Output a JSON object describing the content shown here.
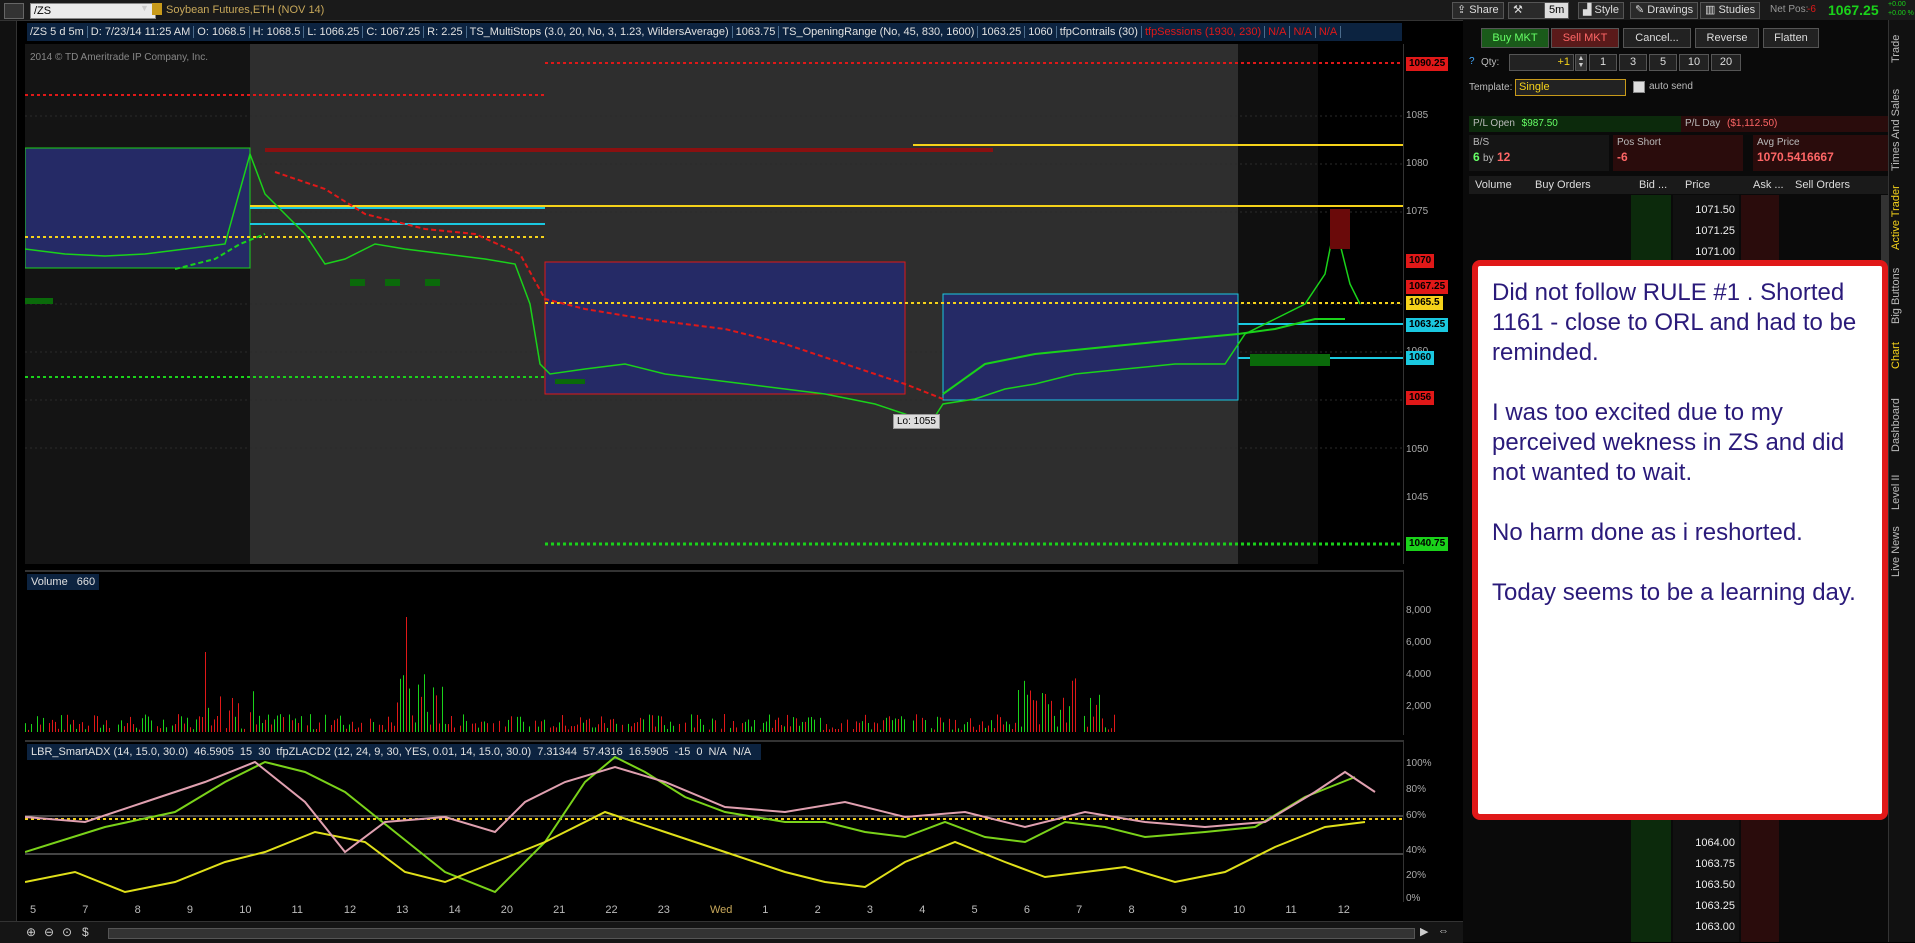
{
  "symbol": {
    "ticker": "/ZS",
    "description": "Soybean Futures,ETH (NOV 14)"
  },
  "toolbar": {
    "share": "Share",
    "style": "Style",
    "drawings": "Drawings",
    "studies": "Studies",
    "aggregation": "5m",
    "net_pos_label": "Net Pos:",
    "net_pos_value": "-6",
    "last_price": "1067.25",
    "change_top": "+0.00",
    "change_bottom": "+0.00 %"
  },
  "info_strip": [
    "/ZS 5 d 5m",
    "D: 7/23/14 11:25 AM",
    "O: 1068.5",
    "H: 1068.5",
    "L: 1066.25",
    "C: 1067.25",
    "R: 2.25",
    "TS_MultiStops (3.0, 20, No, 3, 1.23, WildersAverage)",
    "1063.75",
    "TS_OpeningRange (No, 45, 830, 1600)",
    "1063.25",
    "1060",
    "tfpContrails (30)",
    "tfpSessions (1930, 230)",
    "N/A",
    "N/A",
    "N/A"
  ],
  "copyright": "2014 © TD Ameritrade IP Company, Inc.",
  "price_axis": [
    "1085",
    "1080",
    "1075",
    "1065",
    "1060",
    "1055",
    "1050",
    "1045"
  ],
  "price_tags": [
    {
      "text": "1090.25",
      "color": "#e01818"
    },
    {
      "text": "1070",
      "color": "#e01818"
    },
    {
      "text": "1067.25",
      "color": "#e01818"
    },
    {
      "text": "1065.5",
      "color": "#f5d21a"
    },
    {
      "text": "1063.25",
      "color": "#1ac8e0"
    },
    {
      "text": "1060",
      "color": "#1ac8e0"
    },
    {
      "text": "1056",
      "color": "#e01818"
    },
    {
      "text": "1040.75",
      "color": "#1ad21a"
    }
  ],
  "lo_label": "Lo: 1055",
  "volume_panel": {
    "label": "Volume",
    "value": "660",
    "axis": [
      "8,000",
      "6,000",
      "4,000",
      "2,000"
    ]
  },
  "adx_panel": {
    "labels": [
      "LBR_SmartADX (14, 15.0, 30.0)",
      "46.5905",
      "15",
      "30",
      "tfpZLACD2 (12, 24, 9, 30, YES, 0.01, 14, 15.0, 30.0)",
      "7.31344",
      "57.4316",
      "16.5905",
      "-15",
      "0",
      "N/A",
      "N/A"
    ],
    "axis": [
      "100%",
      "80%",
      "60%",
      "40%",
      "20%",
      "0%"
    ]
  },
  "time_axis": [
    "5",
    "7",
    "8",
    "9",
    "10",
    "11",
    "12",
    "13",
    "14",
    "20",
    "21",
    "22",
    "23",
    "Wed",
    "1",
    "2",
    "3",
    "4",
    "5",
    "6",
    "7",
    "8",
    "9",
    "10",
    "11",
    "12"
  ],
  "trader": {
    "buy_mkt": "Buy MKT",
    "sell_mkt": "Sell MKT",
    "cancel": "Cancel...",
    "reverse": "Reverse",
    "flatten": "Flatten",
    "qty_label": "Qty:",
    "qty_value": "+1",
    "qty_presets": [
      "1",
      "3",
      "5",
      "10",
      "20"
    ],
    "template_label": "Template:",
    "template_value": "Single",
    "auto_send": "auto send",
    "pl_open_label": "P/L Open",
    "pl_open_value": "$987.50",
    "pl_day_label": "P/L Day",
    "pl_day_value": "($1,112.50)",
    "bs_label": "B/S",
    "bs_bid": "6",
    "bs_by": "by",
    "bs_ask": "12",
    "pos_label": "Pos Short",
    "pos_value": "-6",
    "avg_label": "Avg Price",
    "avg_value": "1070.5416667",
    "ladder_headers": [
      "Volume",
      "Buy Orders",
      "Bid ...",
      "Price",
      "Ask ...",
      "Sell Orders"
    ],
    "ladder_top": [
      "1071.50",
      "1071.25",
      "1071.00"
    ],
    "ladder_bottom": [
      "1064.00",
      "1063.75",
      "1063.50",
      "1063.25",
      "1063.00"
    ]
  },
  "note": {
    "lines": [
      " Did not follow RULE #1 . Shorted 1161 - close to ORL and had to be reminded.",
      "I was too excited due to my perceived wekness in ZS and did not wanted to wait.",
      "No harm done as i reshorted.",
      "Today seems to be a learning day."
    ]
  },
  "vertical_tabs": [
    "Trade",
    "Times And Sales",
    "Active Trader",
    "Big Buttons",
    "Chart",
    "Dashboard",
    "Level II",
    "Live News"
  ],
  "colors": {
    "up": "#1ad21a",
    "down": "#e01818",
    "orl": "#1ac8e0",
    "avg": "#f5d21a",
    "session": "#2e2e2e",
    "range_box": "#252a66"
  }
}
